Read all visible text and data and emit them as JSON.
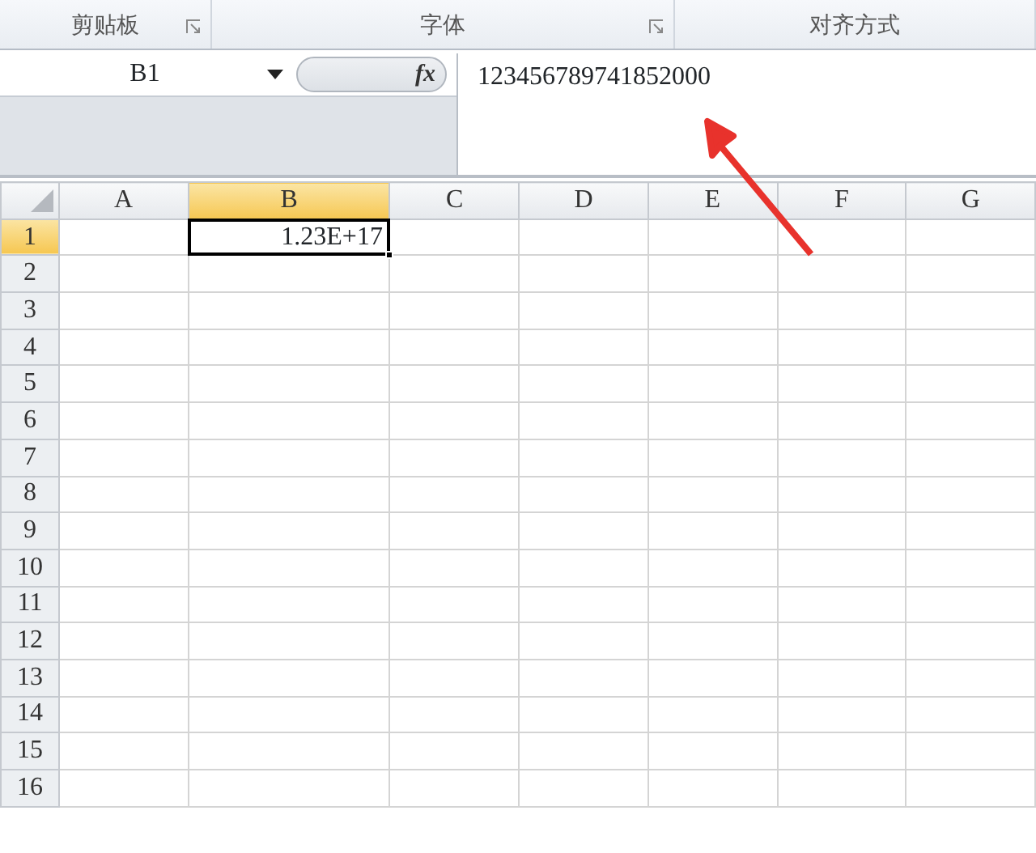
{
  "ribbon_groups": [
    {
      "label": "剪贴板",
      "launcher": true
    },
    {
      "label": "字体",
      "launcher": true
    },
    {
      "label": "对齐方式",
      "launcher": false
    }
  ],
  "name_box": {
    "value": "B1"
  },
  "formula_bar": {
    "fx": "fx",
    "content": "123456789741852000"
  },
  "columns": [
    {
      "label": "A",
      "selected": false
    },
    {
      "label": "B",
      "selected": true
    },
    {
      "label": "C",
      "selected": false
    },
    {
      "label": "D",
      "selected": false
    },
    {
      "label": "E",
      "selected": false
    },
    {
      "label": "F",
      "selected": false
    },
    {
      "label": "G",
      "selected": false
    }
  ],
  "rows": [
    {
      "label": "1",
      "selected": true,
      "cells": [
        {},
        {
          "selected": true,
          "value": "1.23E+17"
        }
      ]
    },
    {
      "label": "2",
      "selected": false
    },
    {
      "label": "3",
      "selected": false
    },
    {
      "label": "4",
      "selected": false
    },
    {
      "label": "5",
      "selected": false
    },
    {
      "label": "6",
      "selected": false
    },
    {
      "label": "7",
      "selected": false
    },
    {
      "label": "8",
      "selected": false
    },
    {
      "label": "9",
      "selected": false
    },
    {
      "label": "10",
      "selected": false
    },
    {
      "label": "11",
      "selected": false
    },
    {
      "label": "12",
      "selected": false
    },
    {
      "label": "13",
      "selected": false
    },
    {
      "label": "14",
      "selected": false
    },
    {
      "label": "15",
      "selected": false
    },
    {
      "label": "16",
      "selected": false
    }
  ]
}
